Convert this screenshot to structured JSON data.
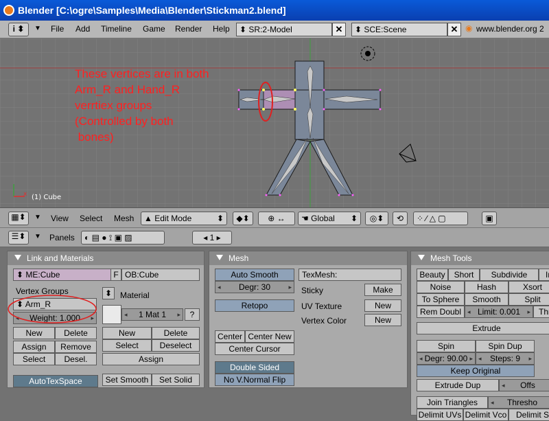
{
  "titlebar": {
    "title": "Blender [C:\\ogre\\Samples\\Media\\Blender\\Stickman2.blend]"
  },
  "menubar": {
    "items": [
      "File",
      "Add",
      "Timeline",
      "Game",
      "Render",
      "Help"
    ],
    "screen": "SR:2-Model",
    "scene": "SCE:Scene",
    "url": "www.blender.org 2"
  },
  "viewport": {
    "annotation": "These vertices are in both\nArm_R and Hand_R\nverrtiex groups\n(Controlled by both\n bones)",
    "object_label": "(1) Cube",
    "header": {
      "menus": [
        "View",
        "Select",
        "Mesh"
      ],
      "mode": "Edit Mode",
      "orientation": "Global"
    }
  },
  "buttons_header": {
    "panels_label": "Panels",
    "frame": "1"
  },
  "link_materials": {
    "title": "Link and Materials",
    "mesh_name": "ME:Cube",
    "f_label": "F",
    "object_name": "OB:Cube",
    "vertex_groups_label": "Vertex Groups",
    "active_group": "Arm_R",
    "weight": "Weight: 1.000",
    "buttons": {
      "new": "New",
      "delete": "Delete",
      "assign": "Assign",
      "remove": "Remove",
      "select": "Select",
      "deselect": "Desel."
    },
    "material_label": "Material",
    "material_slot": "1 Mat 1",
    "question": "?",
    "mat_buttons": {
      "new": "New",
      "delete": "Delete",
      "select": "Select",
      "deselect": "Deselect",
      "assign": "Assign"
    },
    "autotexspace": "AutoTexSpace",
    "set_smooth": "Set Smooth",
    "set_solid": "Set Solid"
  },
  "mesh": {
    "title": "Mesh",
    "auto_smooth": "Auto Smooth",
    "degr": "Degr: 30",
    "retopo": "Retopo",
    "center": "Center",
    "center_new": "Center New",
    "center_cursor": "Center Cursor",
    "double_sided": "Double Sided",
    "no_vnormal_flip": "No V.Normal Flip",
    "texmesh": "TexMesh:",
    "sticky": "Sticky",
    "make": "Make",
    "uv_texture": "UV Texture",
    "uv_new": "New",
    "vertex_color": "Vertex Color",
    "vc_new": "New"
  },
  "mesh_tools": {
    "title": "Mesh Tools",
    "row1": [
      "Beauty",
      "Short",
      "Subdivide",
      "In"
    ],
    "row2": [
      "Noise",
      "Hash",
      "Xsort"
    ],
    "row3": [
      "To Sphere",
      "Smooth",
      "Split"
    ],
    "rem_doubles": "Rem Doubl",
    "limit": "Limit: 0.001",
    "thr": "Thr",
    "extrude": "Extrude",
    "spin": "Spin",
    "spin_dup": "Spin Dup",
    "degr": "Degr: 90.00",
    "steps": "Steps: 9",
    "keep_original": "Keep Original",
    "extrude_dup": "Extrude Dup",
    "offs": "Offs",
    "join_triangles": "Join Triangles",
    "threshold": "Thresho",
    "delimit_uvs": "Delimit UVs",
    "delimit_vco": "Delimit Vco",
    "delimit_s": "Delimit S"
  },
  "colors": {
    "annotation": "#ff2020",
    "titlebar": "#0a4fd0",
    "grid_bg": "#737373"
  }
}
